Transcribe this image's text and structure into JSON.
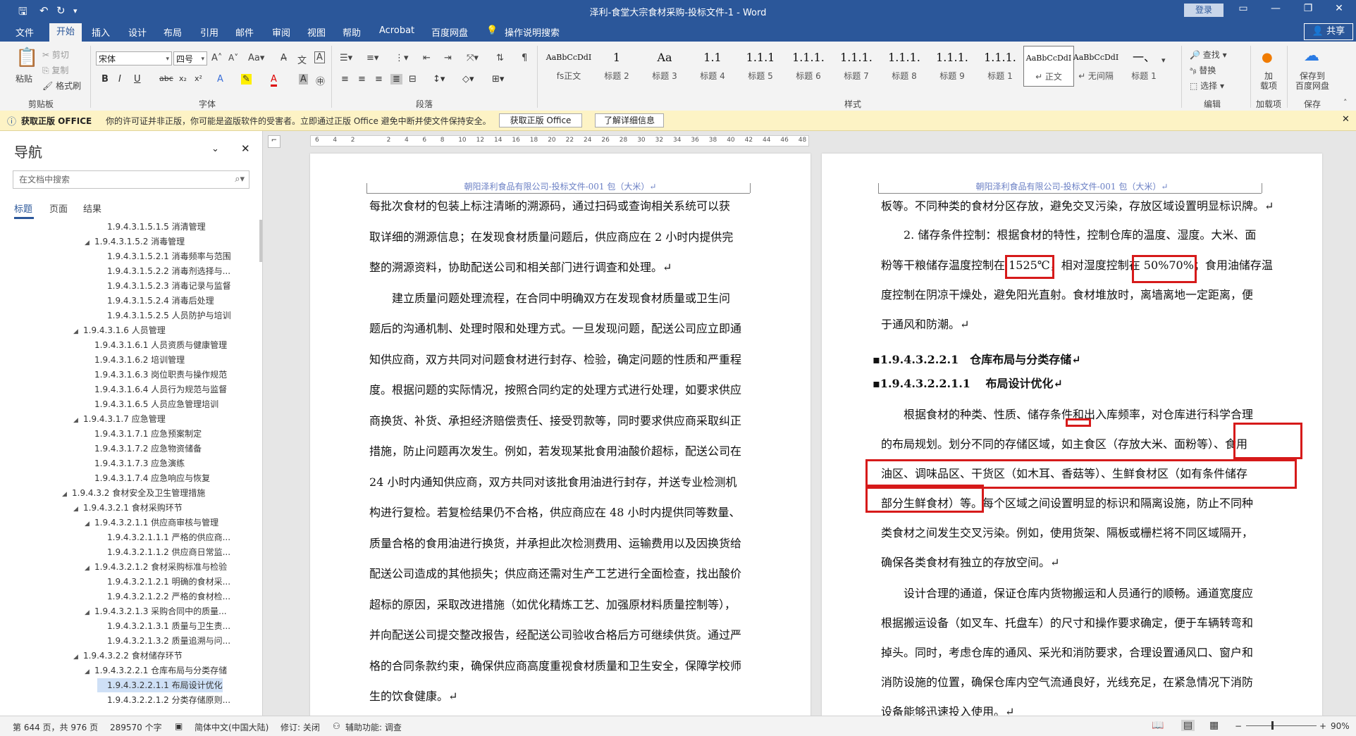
{
  "window": {
    "title": "泽利-食堂大宗食材采购-投标文件-1  -  Word",
    "login": "登录",
    "share": "共享"
  },
  "menu": [
    "文件",
    "开始",
    "插入",
    "设计",
    "布局",
    "引用",
    "邮件",
    "审阅",
    "视图",
    "帮助",
    "Acrobat",
    "百度网盘",
    "操作说明搜索"
  ],
  "ribbon": {
    "clipboard": {
      "paste": "粘贴",
      "cut": "剪切",
      "copy": "复制",
      "format_painter": "格式刷",
      "label": "剪贴板"
    },
    "font": {
      "name": "宋体",
      "size": "四号",
      "label": "字体"
    },
    "paragraph": {
      "label": "段落"
    },
    "styles": {
      "label": "样式",
      "items": [
        {
          "preview": "AaBbCcDdI",
          "name": "fs正文"
        },
        {
          "preview": "1",
          "name": "标题 2"
        },
        {
          "preview": "Aa",
          "name": "标题 3"
        },
        {
          "preview": "1.1",
          "name": "标题 4"
        },
        {
          "preview": "1.1.1",
          "name": "标题 5"
        },
        {
          "preview": "1.1.1.",
          "name": "标题 6"
        },
        {
          "preview": "1.1.1.",
          "name": "标题 7"
        },
        {
          "preview": "1.1.1.",
          "name": "标题 8"
        },
        {
          "preview": "1.1.1.",
          "name": "标题 9"
        },
        {
          "preview": "1.1.1.",
          "name": "标题 1"
        },
        {
          "preview": "AaBbCcDdI",
          "name": "↵ 正文"
        },
        {
          "preview": "AaBbCcDdI",
          "name": "↵ 无间隔"
        },
        {
          "preview": "一、",
          "name": "标题 1"
        }
      ]
    },
    "editing": {
      "find": "查找",
      "replace": "替换",
      "select": "选择",
      "label": "编辑"
    },
    "addins": {
      "btn": "加\n载项",
      "label": "加载项"
    },
    "save": {
      "btn": "保存到\n百度网盘",
      "label": "保存"
    }
  },
  "license": {
    "title": "获取正版 OFFICE",
    "message": "你的许可证并非正版，你可能是盗版软件的受害者。立即通过正版 Office 避免中断并使文件保持安全。",
    "btn_get": "获取正版 Office",
    "btn_info": "了解详细信息"
  },
  "nav": {
    "title": "导航",
    "search_placeholder": "在文档中搜索",
    "tabs": [
      "标题",
      "页面",
      "结果"
    ],
    "items": [
      {
        "text": "1.9.4.3.1.5.1.5 消清管理",
        "level": 4,
        "tri": ""
      },
      {
        "text": "1.9.4.3.1.5.2 消毒管理",
        "level": 3,
        "tri": "◢"
      },
      {
        "text": "1.9.4.3.1.5.2.1 消毒频率与范围",
        "level": 4,
        "tri": ""
      },
      {
        "text": "1.9.4.3.1.5.2.2 消毒剂选择与...",
        "level": 4,
        "tri": ""
      },
      {
        "text": "1.9.4.3.1.5.2.3 消毒记录与监督",
        "level": 4,
        "tri": ""
      },
      {
        "text": "1.9.4.3.1.5.2.4 消毒后处理",
        "level": 4,
        "tri": ""
      },
      {
        "text": "1.9.4.3.1.5.2.5 人员防护与培训",
        "level": 4,
        "tri": ""
      },
      {
        "text": "1.9.4.3.1.6 人员管理",
        "level": 2,
        "tri": "◢"
      },
      {
        "text": "1.9.4.3.1.6.1 人员资质与健康管理",
        "level": 3,
        "tri": ""
      },
      {
        "text": "1.9.4.3.1.6.2 培训管理",
        "level": 3,
        "tri": ""
      },
      {
        "text": "1.9.4.3.1.6.3 岗位职责与操作规范",
        "level": 3,
        "tri": ""
      },
      {
        "text": "1.9.4.3.1.6.4 人员行为规范与监督",
        "level": 3,
        "tri": ""
      },
      {
        "text": "1.9.4.3.1.6.5 人员应急管理培训",
        "level": 3,
        "tri": ""
      },
      {
        "text": "1.9.4.3.1.7 应急管理",
        "level": 2,
        "tri": "◢"
      },
      {
        "text": "1.9.4.3.1.7.1 应急预案制定",
        "level": 3,
        "tri": ""
      },
      {
        "text": "1.9.4.3.1.7.2 应急物资储备",
        "level": 3,
        "tri": ""
      },
      {
        "text": "1.9.4.3.1.7.3 应急演练",
        "level": 3,
        "tri": ""
      },
      {
        "text": "1.9.4.3.1.7.4 应急响应与恢复",
        "level": 3,
        "tri": ""
      },
      {
        "text": "1.9.4.3.2 食材安全及卫生管理措施",
        "level": 1,
        "tri": "◢"
      },
      {
        "text": "1.9.4.3.2.1 食材采购环节",
        "level": 2,
        "tri": "◢"
      },
      {
        "text": "1.9.4.3.2.1.1 供应商审核与管理",
        "level": 3,
        "tri": "◢"
      },
      {
        "text": "1.9.4.3.2.1.1.1 严格的供应商...",
        "level": 4,
        "tri": ""
      },
      {
        "text": "1.9.4.3.2.1.1.2 供应商日常监...",
        "level": 4,
        "tri": ""
      },
      {
        "text": "1.9.4.3.2.1.2 食材采购标准与检验",
        "level": 3,
        "tri": "◢"
      },
      {
        "text": "1.9.4.3.2.1.2.1 明确的食材采...",
        "level": 4,
        "tri": ""
      },
      {
        "text": "1.9.4.3.2.1.2.2 严格的食材检...",
        "level": 4,
        "tri": ""
      },
      {
        "text": "1.9.4.3.2.1.3 采购合同中的质量...",
        "level": 3,
        "tri": "◢"
      },
      {
        "text": "1.9.4.3.2.1.3.1 质量与卫生责...",
        "level": 4,
        "tri": ""
      },
      {
        "text": "1.9.4.3.2.1.3.2 质量追溯与问...",
        "level": 4,
        "tri": ""
      },
      {
        "text": "1.9.4.3.2.2 食材储存环节",
        "level": 2,
        "tri": "◢"
      },
      {
        "text": "1.9.4.3.2.2.1 仓库布局与分类存储",
        "level": 3,
        "tri": "◢"
      },
      {
        "text": "1.9.4.3.2.2.1.1 布局设计优化",
        "level": 4,
        "tri": "",
        "selected": true
      },
      {
        "text": "1.9.4.3.2.2.1.2 分类存储原则...",
        "level": 4,
        "tri": ""
      }
    ]
  },
  "ruler": [
    "6",
    "4",
    "2",
    "",
    "2",
    "4",
    "6",
    "8",
    "10",
    "12",
    "14",
    "16",
    "18",
    "20",
    "22",
    "24",
    "26",
    "28",
    "30",
    "32",
    "34",
    "36",
    "38",
    "40",
    "42",
    "44",
    "46",
    "48"
  ],
  "page_header": "朝阳泽利食品有限公司-投标文件-001 包（大米）↵",
  "page_left": [
    {
      "t": "每批次食材的包装上标注清晰的溯源码，通过扫码或查询相关系统可以获",
      "h": false
    },
    {
      "t": "取详细的溯源信息；在发现食材质量问题后，供应商应在 2 小时内提供完",
      "h": false
    },
    {
      "t": "整的溯源资料，协助配送公司和相关部门进行调查和处理。↵",
      "h": false
    },
    {
      "t": "　　建立质量问题处理流程，在合同中明确双方在发现食材质量或卫生问",
      "h": false
    },
    {
      "t": "题后的沟通机制、处理时限和处理方式。一旦发现问题，配送公司应立即通",
      "h": false
    },
    {
      "t": "知供应商，双方共同对问题食材进行封存、检验，确定问题的性质和严重程",
      "h": false
    },
    {
      "t": "度。根据问题的实际情况，按照合同约定的处理方式进行处理，如要求供应",
      "h": false
    },
    {
      "t": "商换货、补货、承担经济赔偿责任、接受罚款等，同时要求供应商采取纠正",
      "h": false
    },
    {
      "t": "措施，防止问题再次发生。例如，若发现某批食用油酸价超标，配送公司在",
      "h": false
    },
    {
      "t": "24 小时内通知供应商，双方共同对该批食用油进行封存，并送专业检测机",
      "h": false
    },
    {
      "t": "构进行复检。若复检结果仍不合格，供应商应在 48 小时内提供同等数量、",
      "h": false
    },
    {
      "t": "质量合格的食用油进行换货，并承担此次检测费用、运输费用以及因换货给",
      "h": false
    },
    {
      "t": "配送公司造成的其他损失；供应商还需对生产工艺进行全面检查，找出酸价",
      "h": false
    },
    {
      "t": "超标的原因，采取改进措施（如优化精炼工艺、加强原材料质量控制等），",
      "h": false
    },
    {
      "t": "并向配送公司提交整改报告，经配送公司验收合格后方可继续供货。通过严",
      "h": false
    },
    {
      "t": "格的合同条款约束，确保供应商高度重视食材质量和卫生安全，保障学校师",
      "h": false
    },
    {
      "t": "生的饮食健康。↵",
      "h": false
    }
  ],
  "page_right": [
    {
      "t": "板等。不同种类的食材分区存放，避免交叉污染，存放区域设置明显标识牌。↵",
      "h": false
    },
    {
      "t": "　　2. 储存条件控制：根据食材的特性，控制仓库的温度、湿度。大米、面",
      "h": false
    },
    {
      "t": "粉等干粮储存温度控制在 1525℃，相对湿度控制在 50%70%；食用油储存温",
      "h": false
    },
    {
      "t": "度控制在阴凉干燥处，避免阳光直射。食材堆放时，离墙离地一定距离，便",
      "h": false
    },
    {
      "t": "于通风和防潮。↵",
      "h": false
    },
    {
      "t": "▪1.9.4.3.2.2.1　仓库布局与分类存储↵",
      "h": true
    },
    {
      "t": "▪1.9.4.3.2.2.1.1　 布局设计优化↵",
      "h": true
    },
    {
      "t": "　　根据食材的种类、性质、储存条件和出入库频率，对仓库进行科学合理",
      "h": false
    },
    {
      "t": "的布局规划。划分不同的存储区域，如主食区（存放大米、面粉等）、食用",
      "h": false
    },
    {
      "t": "油区、调味品区、干货区（如木耳、香菇等）、生鲜食材区（如有条件储存",
      "h": false
    },
    {
      "t": "部分生鲜食材）等。每个区域之间设置明显的标识和隔离设施，防止不同种",
      "h": false
    },
    {
      "t": "类食材之间发生交叉污染。例如，使用货架、隔板或栅栏将不同区域隔开，",
      "h": false
    },
    {
      "t": "确保各类食材有独立的存放空间。↵",
      "h": false
    },
    {
      "t": "　　设计合理的通道，保证仓库内货物搬运和人员通行的顺畅。通道宽度应",
      "h": false
    },
    {
      "t": "根据搬运设备（如叉车、托盘车）的尺寸和操作要求确定，便于车辆转弯和",
      "h": false
    },
    {
      "t": "掉头。同时，考虑仓库的通风、采光和消防要求，合理设置通风口、窗户和",
      "h": false
    },
    {
      "t": "消防设施的位置，确保仓库内空气流通良好，光线充足，在紧急情况下消防",
      "h": false
    },
    {
      "t": "设备能够迅速投入使用。↵",
      "h": false
    }
  ],
  "status": {
    "page": "第 644 页，共 976 页",
    "words": "289570 个字",
    "lang": "简体中文(中国大陆)",
    "track": "修订: 关闭",
    "access": "辅助功能: 调查",
    "zoom": "90%"
  }
}
